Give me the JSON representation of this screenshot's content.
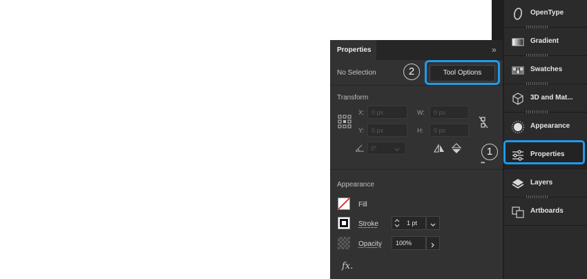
{
  "dock": {
    "items": [
      {
        "id": "opentype",
        "label": "OpenType",
        "icon": "opentype-icon"
      },
      {
        "id": "gradient",
        "label": "Gradient",
        "icon": "gradient-icon"
      },
      {
        "id": "swatches",
        "label": "Swatches",
        "icon": "swatches-icon"
      },
      {
        "id": "3d",
        "label": "3D and Mat...",
        "icon": "cube-icon"
      },
      {
        "id": "appearance",
        "label": "Appearance",
        "icon": "appearance-icon"
      },
      {
        "id": "properties",
        "label": "Properties",
        "icon": "sliders-icon"
      },
      {
        "id": "layers",
        "label": "Layers",
        "icon": "layers-icon"
      },
      {
        "id": "artboards",
        "label": "Artboards",
        "icon": "artboards-icon"
      }
    ]
  },
  "panel": {
    "tab_label": "Properties",
    "collapse_glyph": "»",
    "selection_label": "No Selection",
    "tool_options_label": "Tool Options",
    "transform": {
      "title": "Transform",
      "x_label": "X:",
      "x_value": "0 px",
      "y_label": "Y:",
      "y_value": "0 px",
      "w_label": "W:",
      "w_value": "0 px",
      "h_label": "H:",
      "h_value": "0 px",
      "angle_value": "0°",
      "more_glyph": "•••"
    },
    "appearance": {
      "title": "Appearance",
      "fill_label": "Fill",
      "stroke_label": "Stroke",
      "stroke_value": "1 pt",
      "opacity_label": "Opacity",
      "opacity_value": "100%",
      "fx_label": "fx."
    }
  },
  "annotations": {
    "badge_1": "1",
    "badge_2": "2",
    "highlight_color": "#1e9bf0"
  }
}
